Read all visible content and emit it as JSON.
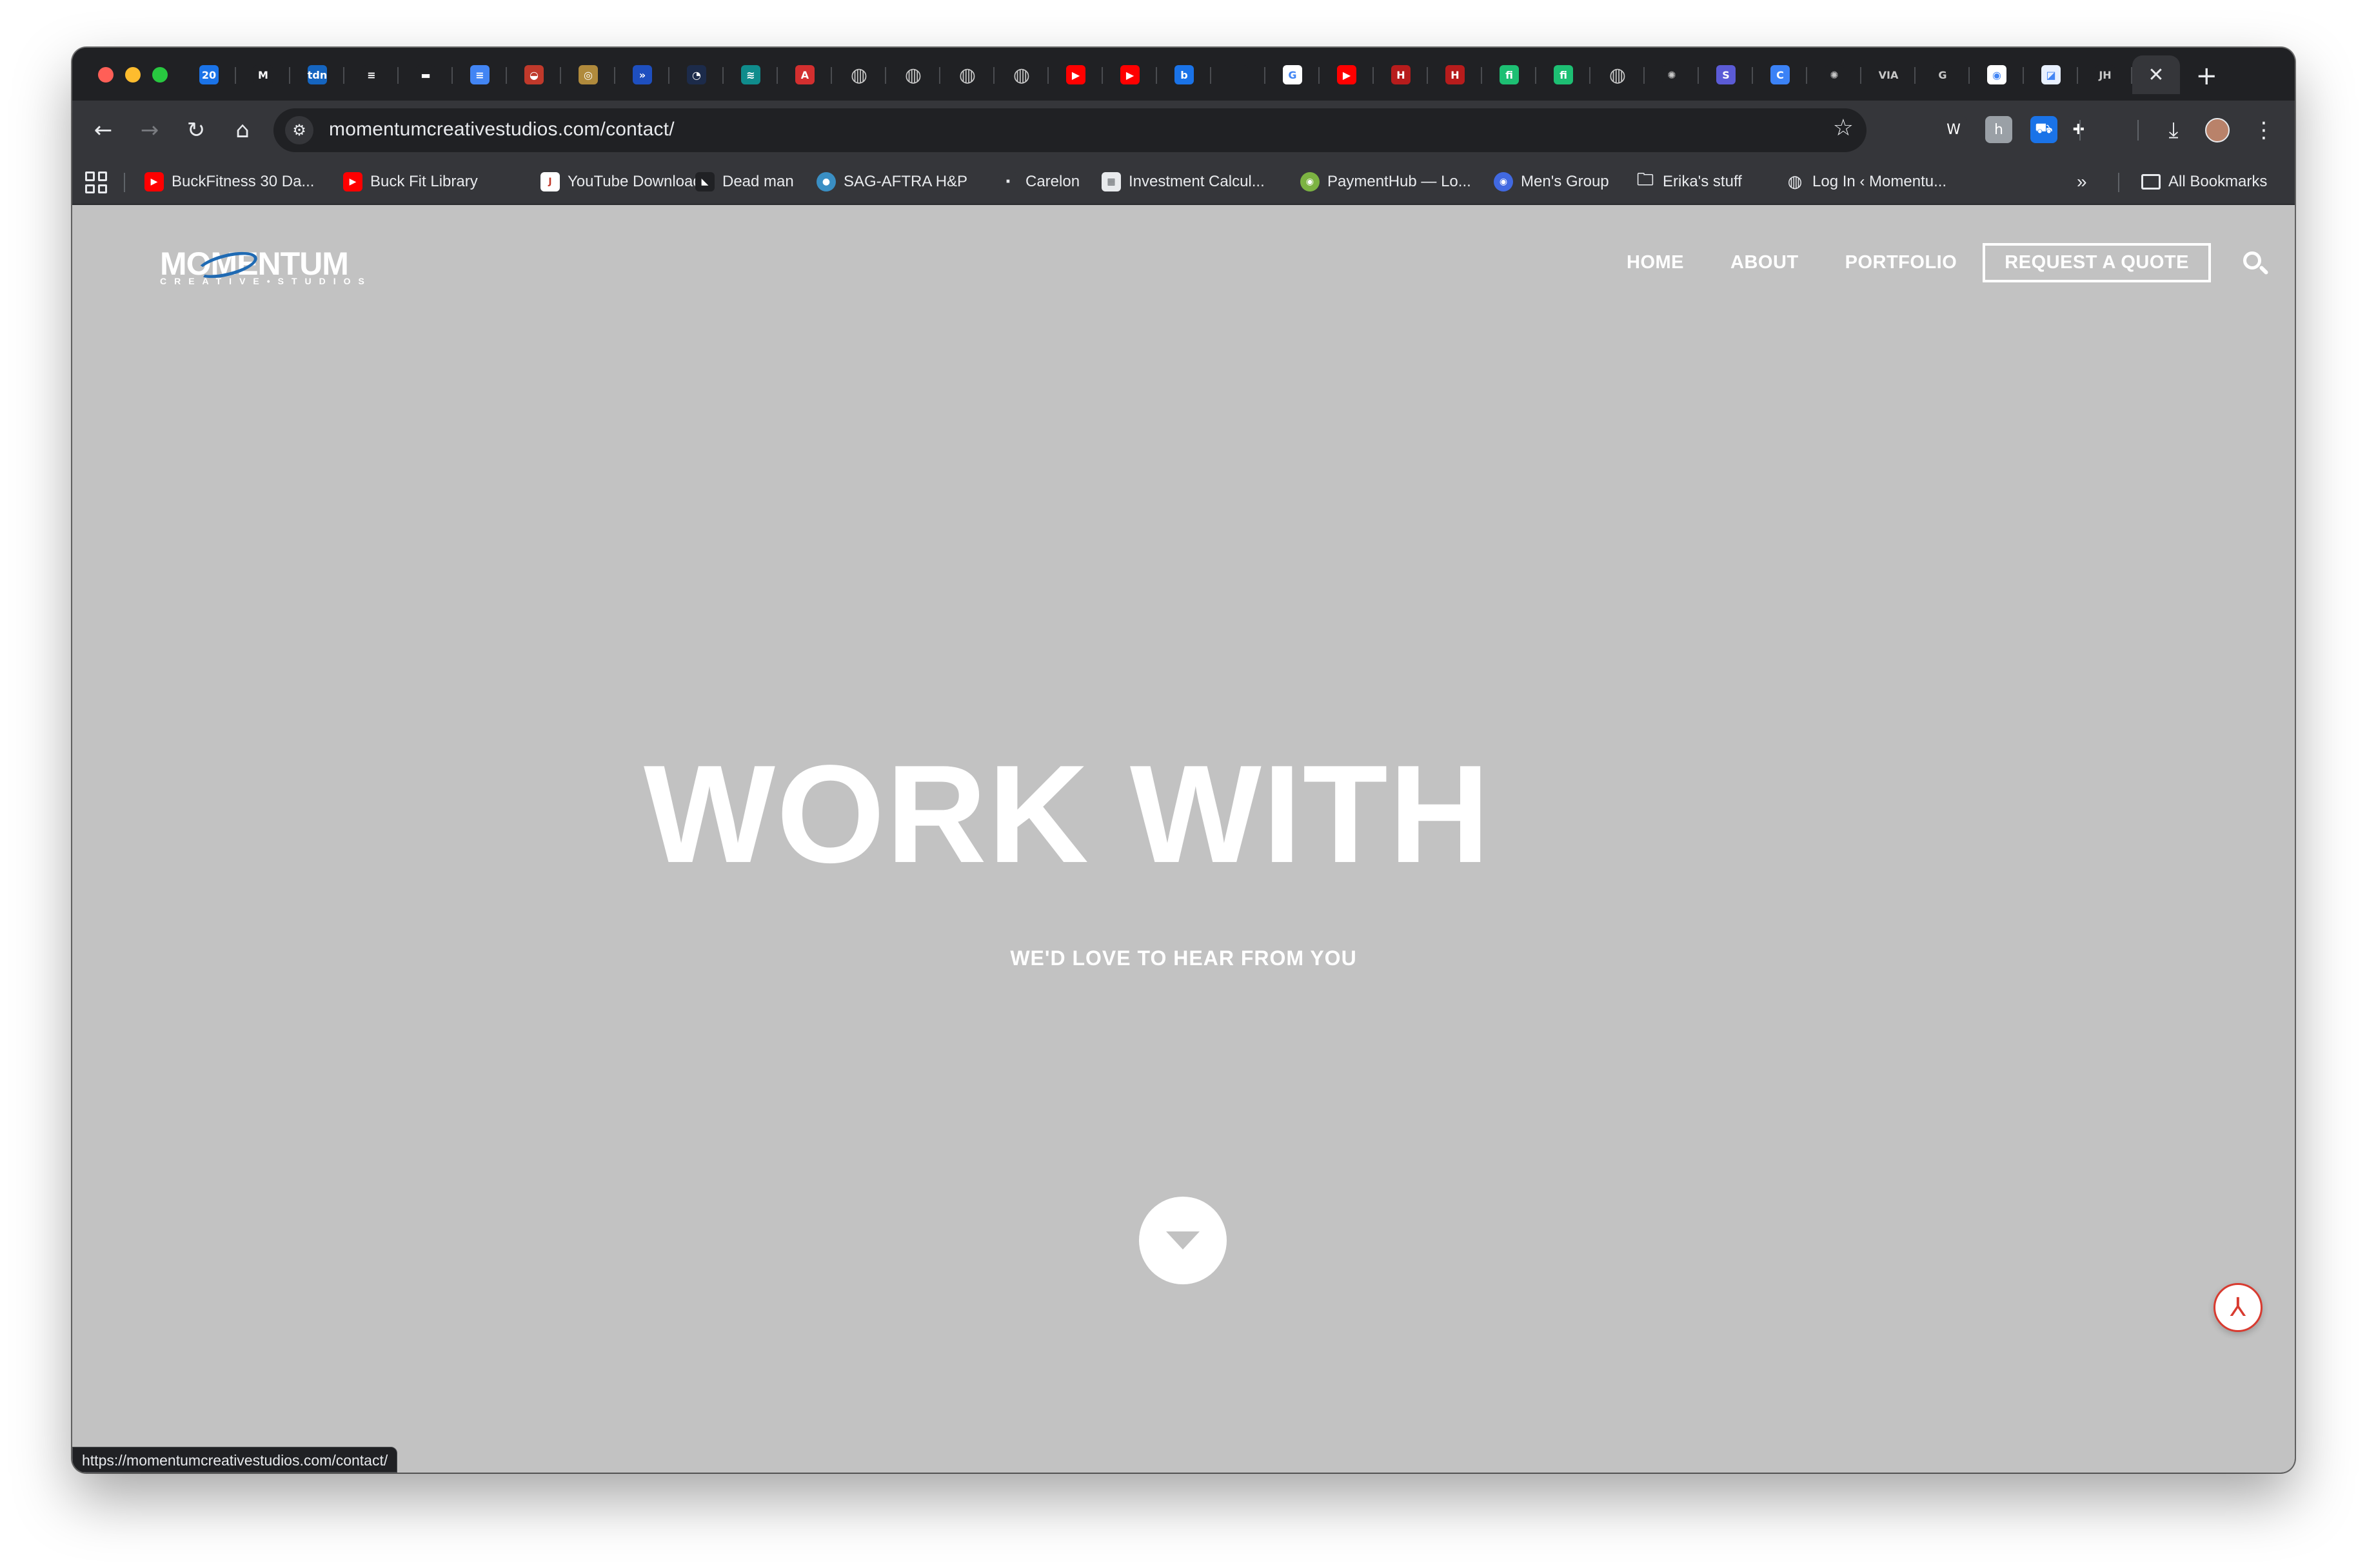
{
  "tabs": [
    {
      "icon": "calendar-icon",
      "color": "#1a73e8",
      "glyph": "20"
    },
    {
      "icon": "gmail-icon",
      "color": "#202124",
      "glyph": "M"
    },
    {
      "icon": "tdn-icon",
      "color": "#1565c0",
      "glyph": "tdn"
    },
    {
      "icon": "buffer-icon",
      "color": "#202124",
      "glyph": "≡"
    },
    {
      "icon": "tv-icon",
      "color": "#202124",
      "glyph": "▬"
    },
    {
      "icon": "docs-icon",
      "color": "#4285f4",
      "glyph": "≡"
    },
    {
      "icon": "dome-icon",
      "color": "#c0392b",
      "glyph": "◒"
    },
    {
      "icon": "medal-icon",
      "color": "#b08a3c",
      "glyph": "◎"
    },
    {
      "icon": "jira-icon",
      "color": "#1e4fbf",
      "glyph": "»"
    },
    {
      "icon": "wave-icon",
      "color": "#1c2b4a",
      "glyph": "◔"
    },
    {
      "icon": "layers-icon",
      "color": "#0f8c8c",
      "glyph": "≋"
    },
    {
      "icon": "acrobat-icon",
      "color": "#d32f2f",
      "glyph": "A"
    },
    {
      "icon": "globe-icon",
      "color": "#888888",
      "glyph": "◍"
    },
    {
      "icon": "globe-icon",
      "color": "#888888",
      "glyph": "◍"
    },
    {
      "icon": "globe-icon",
      "color": "#888888",
      "glyph": "◍"
    },
    {
      "icon": "globe-icon",
      "color": "#888888",
      "glyph": "◍"
    },
    {
      "icon": "youtube-icon",
      "color": "#ff0000",
      "glyph": "▶"
    },
    {
      "icon": "youtube-icon",
      "color": "#ff0000",
      "glyph": "▶"
    },
    {
      "icon": "b-icon",
      "color": "#1a73e8",
      "glyph": "b"
    },
    {
      "icon": "blank-icon",
      "color": "#202124",
      "glyph": ""
    },
    {
      "icon": "google-icon",
      "color": "#ffffff",
      "glyph": "G"
    },
    {
      "icon": "youtube-icon",
      "color": "#ff0000",
      "glyph": "▶"
    },
    {
      "icon": "h-icon",
      "color": "#b71c1c",
      "glyph": "H"
    },
    {
      "icon": "h-icon",
      "color": "#b71c1c",
      "glyph": "H"
    },
    {
      "icon": "fiverr-icon",
      "color": "#1dbf73",
      "glyph": "fi"
    },
    {
      "icon": "fiverr-icon",
      "color": "#1dbf73",
      "glyph": "fi"
    },
    {
      "icon": "globe-icon",
      "color": "#888888",
      "glyph": "◍"
    },
    {
      "icon": "openai-icon",
      "color": "#202124",
      "glyph": "✺"
    },
    {
      "icon": "s-icon",
      "color": "#5b5bd6",
      "glyph": "S"
    },
    {
      "icon": "c-icon",
      "color": "#3b82f6",
      "glyph": "C"
    },
    {
      "icon": "openai-icon",
      "color": "#202124",
      "glyph": "✺"
    },
    {
      "icon": "via-icon",
      "color": "#202124",
      "glyph": "VIA"
    },
    {
      "icon": "g-icon",
      "color": "#202124",
      "glyph": "G"
    },
    {
      "icon": "chrome-icon",
      "color": "#ffffff",
      "glyph": "◉"
    },
    {
      "icon": "edit-icon",
      "color": "#e8f0fe",
      "glyph": "◪"
    },
    {
      "icon": "jh-icon",
      "color": "#202124",
      "glyph": "JH"
    }
  ],
  "active_tab": {
    "close_glyph": "✕"
  },
  "new_tab_glyph": "+",
  "toolbar": {
    "back": "←",
    "forward": "→",
    "reload": "↻",
    "home": "⌂",
    "url": "momentumcreativestudios.com/contact/",
    "star": "☆",
    "menu": "⋮",
    "downloads": "⤓",
    "extensions": [
      {
        "icon": "w-extension-icon",
        "glyph": "W",
        "color": "#35363a"
      },
      {
        "icon": "grey-extension-icon",
        "glyph": "h",
        "color": "#9aa0a6"
      },
      {
        "icon": "cart-extension-icon",
        "glyph": "⛟",
        "color": "#1a73e8"
      },
      {
        "icon": "puzzle-icon",
        "glyph": "✚",
        "color": "#35363a"
      },
      {
        "icon": "tab-search-icon",
        "glyph": "⧉",
        "color": "#35363a"
      }
    ]
  },
  "bookmarks": [
    {
      "label": "BuckFitness 30 Da...",
      "icon": "youtube-icon",
      "color": "#ff0000",
      "glyph": "▶"
    },
    {
      "label": "Buck Fit Library",
      "icon": "youtube-icon",
      "color": "#ff0000",
      "glyph": "▶"
    },
    {
      "label": "YouTube Download",
      "icon": "jft-icon",
      "color": "#ffffff",
      "glyph": "J"
    },
    {
      "label": "Dead man",
      "icon": "shoe-icon",
      "color": "#202124",
      "glyph": "◣"
    },
    {
      "label": "SAG-AFTRA H&P",
      "icon": "sag-icon",
      "color": "#3a8fc4",
      "glyph": "●"
    },
    {
      "label": "Carelon",
      "icon": "carelon-icon",
      "color": "#35363a",
      "glyph": "·"
    },
    {
      "label": "Investment Calcul...",
      "icon": "calculator-icon",
      "color": "#e8eaed",
      "glyph": "▦"
    },
    {
      "label": "PaymentHub — Lo...",
      "icon": "paymenthub-icon",
      "color": "#7cb342",
      "glyph": "◉"
    },
    {
      "label": "Men's Group",
      "icon": "mens-group-icon",
      "color": "#4169e1",
      "glyph": "◉"
    },
    {
      "label": "Erika's stuff",
      "icon": "folder-icon",
      "color": "#35363a",
      "glyph": "🗀"
    },
    {
      "label": "Log In ‹ Momentu...",
      "icon": "globe-icon",
      "color": "#35363a",
      "glyph": "◍"
    }
  ],
  "bookmarks_overflow": "»",
  "all_bookmarks": "All Bookmarks",
  "site": {
    "logo_word": "MOMENTUM",
    "logo_sub": "CREATIVE•STUDIOS",
    "nav": [
      "HOME",
      "ABOUT",
      "PORTFOLIO"
    ],
    "cta": "REQUEST A QUOTE",
    "hero_title": "WORK WITH",
    "hero_subtitle": "WE'D LOVE TO HEAR FROM YOU",
    "background": "#c2c2c2",
    "accent": "#1f6ab3"
  },
  "status_url": "https://momentumcreativestudios.com/contact/"
}
